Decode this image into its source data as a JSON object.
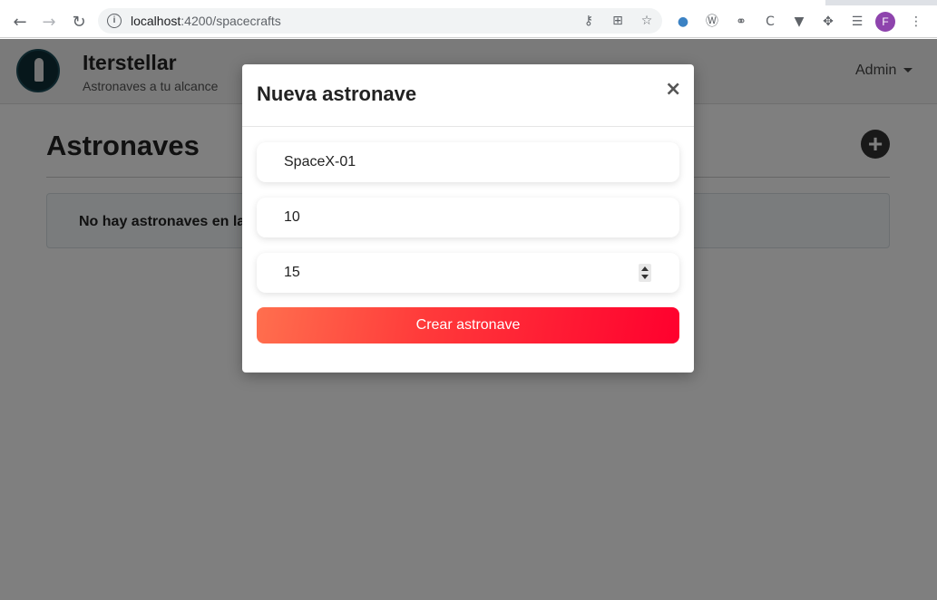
{
  "browser": {
    "url_host": "localhost",
    "url_path": ":4200/spacecrafts",
    "profile_initial": "F"
  },
  "app": {
    "brand_title": "Iterstellar",
    "brand_subtitle": "Astronaves a tu alcance",
    "admin_label": "Admin",
    "page_title": "Astronaves",
    "empty_message": "No hay astronaves en la p"
  },
  "modal": {
    "title": "Nueva astronave",
    "close": "×",
    "name_value": "SpaceX-01",
    "field2_value": "10",
    "field3_value": "15",
    "submit_label": "Crear astronave"
  }
}
